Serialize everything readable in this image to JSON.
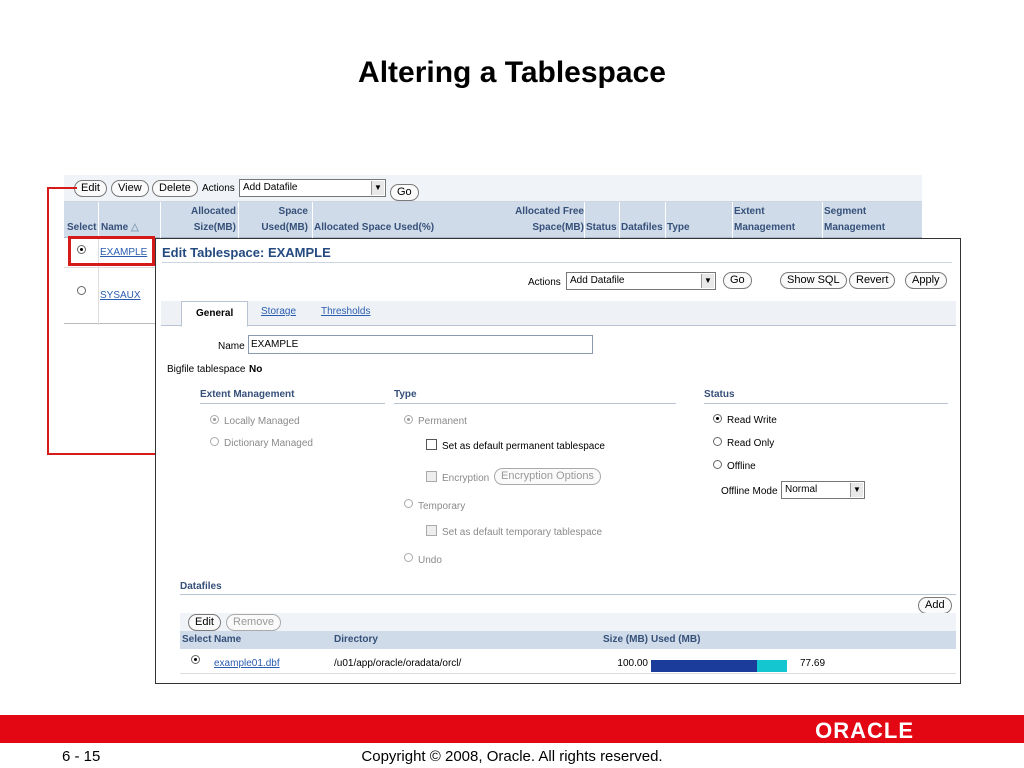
{
  "slide": {
    "title": "Altering a Tablespace",
    "page": "6 - 15",
    "copyright": "Copyright © 2008, Oracle. All rights reserved.",
    "logo": "ORACLE"
  },
  "list_view": {
    "buttons": {
      "edit": "Edit",
      "view": "View",
      "delete": "Delete"
    },
    "actions_label": "Actions",
    "actions_value": "Add Datafile",
    "go": "Go",
    "columns": {
      "select": "Select",
      "name": "Name",
      "allocated_size": [
        "Allocated",
        "Size(MB)"
      ],
      "space_used": [
        "Space",
        "Used(MB)"
      ],
      "allocated_space_used_pct": "Allocated Space Used(%)",
      "allocated_free": [
        "Allocated Free",
        "Space(MB)"
      ],
      "status": "Status",
      "datafiles": "Datafiles",
      "type": "Type",
      "extent_management": [
        "Extent",
        "Management"
      ],
      "segment_management": [
        "Segment",
        "Management"
      ]
    },
    "rows": [
      {
        "name": "EXAMPLE",
        "selected": true
      },
      {
        "name": "SYSAUX",
        "selected": false
      }
    ]
  },
  "edit": {
    "title": "Edit Tablespace: EXAMPLE",
    "actions_label": "Actions",
    "actions_value": "Add Datafile",
    "go": "Go",
    "show_sql": "Show SQL",
    "revert": "Revert",
    "apply": "Apply",
    "tabs": [
      "General",
      "Storage",
      "Thresholds"
    ],
    "name_label": "Name",
    "name_value": "EXAMPLE",
    "bigfile_label": "Bigfile tablespace",
    "bigfile_value": "No",
    "extent": {
      "heading": "Extent Management",
      "options": [
        "Locally Managed",
        "Dictionary Managed"
      ]
    },
    "type": {
      "heading": "Type",
      "permanent": "Permanent",
      "default_permanent": "Set as default permanent tablespace",
      "encryption": "Encryption",
      "encryption_options": "Encryption Options",
      "temporary": "Temporary",
      "default_temporary": "Set as default temporary tablespace",
      "undo": "Undo"
    },
    "status": {
      "heading": "Status",
      "options": [
        "Read Write",
        "Read Only",
        "Offline"
      ],
      "offline_mode_label": "Offline Mode",
      "offline_mode_value": "Normal"
    },
    "datafiles": {
      "heading": "Datafiles",
      "add": "Add",
      "edit": "Edit",
      "remove": "Remove",
      "columns": [
        "Select",
        "Name",
        "Directory",
        "Size (MB)",
        "Used (MB)"
      ],
      "rows": [
        {
          "name": "example01.dbf",
          "directory": "/u01/app/oracle/oradata/orcl/",
          "size": "100.00",
          "used": "77.69",
          "used_fraction": 0.7769
        }
      ]
    }
  },
  "colors": {
    "accent_red": "#d61a1a",
    "footer_red": "#e30613",
    "header_blue": "#cfdbe8",
    "used_bar": "#1c3c9c",
    "free_bar": "#13c6cf"
  }
}
